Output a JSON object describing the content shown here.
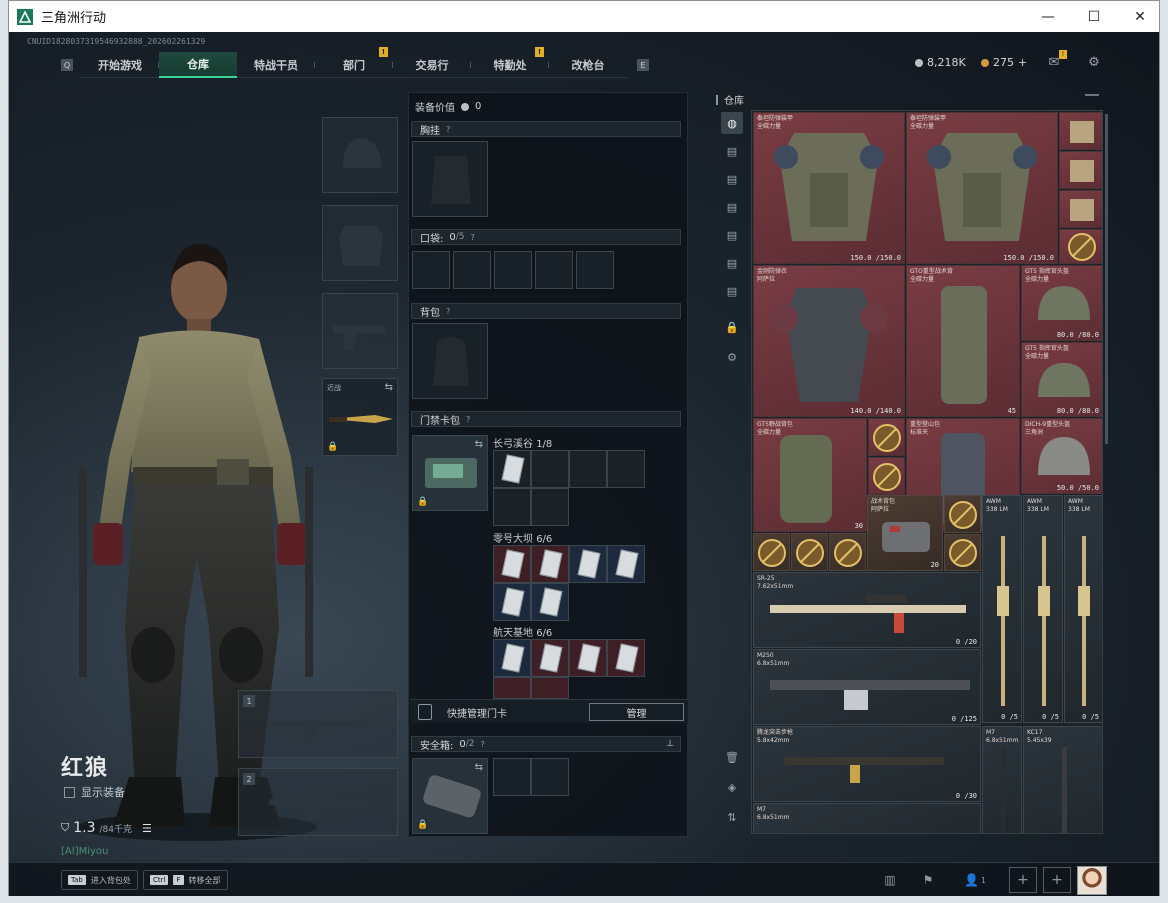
{
  "window": {
    "title": "三角洲行动"
  },
  "header": {
    "cnid": "CNUID1828037319546932888_202602261329",
    "nav_left_key": "Q",
    "nav_right_key": "E",
    "tabs": [
      "开始游戏",
      "仓库",
      "特战干员",
      "部门",
      "交易行",
      "特勤处",
      "改枪台"
    ],
    "alert_badge": "!",
    "currency_a": "8,218K",
    "currency_b": "275",
    "currency_b_plus": "+"
  },
  "operator": {
    "name": "红狼",
    "show_equipment": "显示装备",
    "weight": "1.3",
    "weight_max": "/84千克",
    "faint_text": "[AI]Miyou"
  },
  "equipment": {
    "melee_label": "近战",
    "weapon_slot_1": "1",
    "weapon_slot_2": "2"
  },
  "loadout": {
    "value_label": "装备价值",
    "value": "0",
    "chest_rig": "胸挂",
    "pockets": "口袋:",
    "pockets_count": "0",
    "pockets_max": "/5",
    "backpack": "背包",
    "keycard_bag": "门禁卡包",
    "maps": [
      {
        "name": "长弓溪谷",
        "count": "1/8"
      },
      {
        "name": "零号大坝",
        "count": "6/6"
      },
      {
        "name": "航天基地",
        "count": "6/6"
      }
    ],
    "quick_manage": "快捷管理门卡",
    "manage_button": "管理",
    "safebox": "安全箱:",
    "safebox_count": "0",
    "safebox_max": "/2"
  },
  "warehouse": {
    "title": "仓库",
    "cells": [
      {
        "name": "泰坦防弹装甲\n全碳力量",
        "dur": "150.0 /150.0",
        "type": "armor"
      },
      {
        "name": "泰坦防弹装甲\n全碳力量",
        "dur": "150.0 /150.0",
        "type": "armor"
      },
      {
        "name": "金刚防弹衣\n阿萨拉",
        "dur": "140.0 /140.0",
        "type": "armor"
      },
      {
        "name": "GTO重型战术背\n全碳力量",
        "dur": "45",
        "type": "armor"
      },
      {
        "name": "GT5 指挥官头盔\n全碳力量",
        "dur": "80.0 /80.0",
        "type": "armor"
      },
      {
        "name": "GT5 指挥官头盔\n全碳力量",
        "dur": "80.0 /80.0",
        "type": "armor"
      },
      {
        "name": "GT5野战背包\n全碳力量",
        "dur": "30",
        "type": "armor"
      },
      {
        "name": "重型登山包\n标准天",
        "dur": "40",
        "type": "armor"
      },
      {
        "name": "DICH-9重型头盔\n三角洲",
        "dur": "50.0 /50.0",
        "type": "armor"
      },
      {
        "name": "战术背包\n阿萨拉",
        "dur": "20",
        "type": "gold"
      },
      {
        "name": "SR-25\n7.62x51mm",
        "dur": "0 /20",
        "type": "grey"
      },
      {
        "name": "M250\n6.8x51mm",
        "dur": "0 /125",
        "type": "grey"
      },
      {
        "name": "AWM\n338 LM",
        "dur": "0 /5",
        "type": "grey"
      },
      {
        "name": "AWM\n338 LM",
        "dur": "0 /5",
        "type": "grey"
      },
      {
        "name": "AWM\n338 LM",
        "dur": "0 /5",
        "type": "grey"
      },
      {
        "name": "腾龙突击步枪\n5.8x42mm",
        "dur": "0 /30",
        "type": "grey"
      },
      {
        "name": "M7\n6.8x51mm",
        "dur": "",
        "type": "grey"
      },
      {
        "name": "KC17\n5.45x39",
        "dur": "",
        "type": "grey"
      },
      {
        "name": "M7\n6.8x51mm",
        "dur": "",
        "type": "grey"
      }
    ]
  },
  "bottombar": {
    "hint1_key": "Tab",
    "hint1_text": "进入背包处",
    "hint2_key": "Ctrl",
    "hint2_key2": "F",
    "hint2_text": "转移全部",
    "party_count": "1"
  }
}
